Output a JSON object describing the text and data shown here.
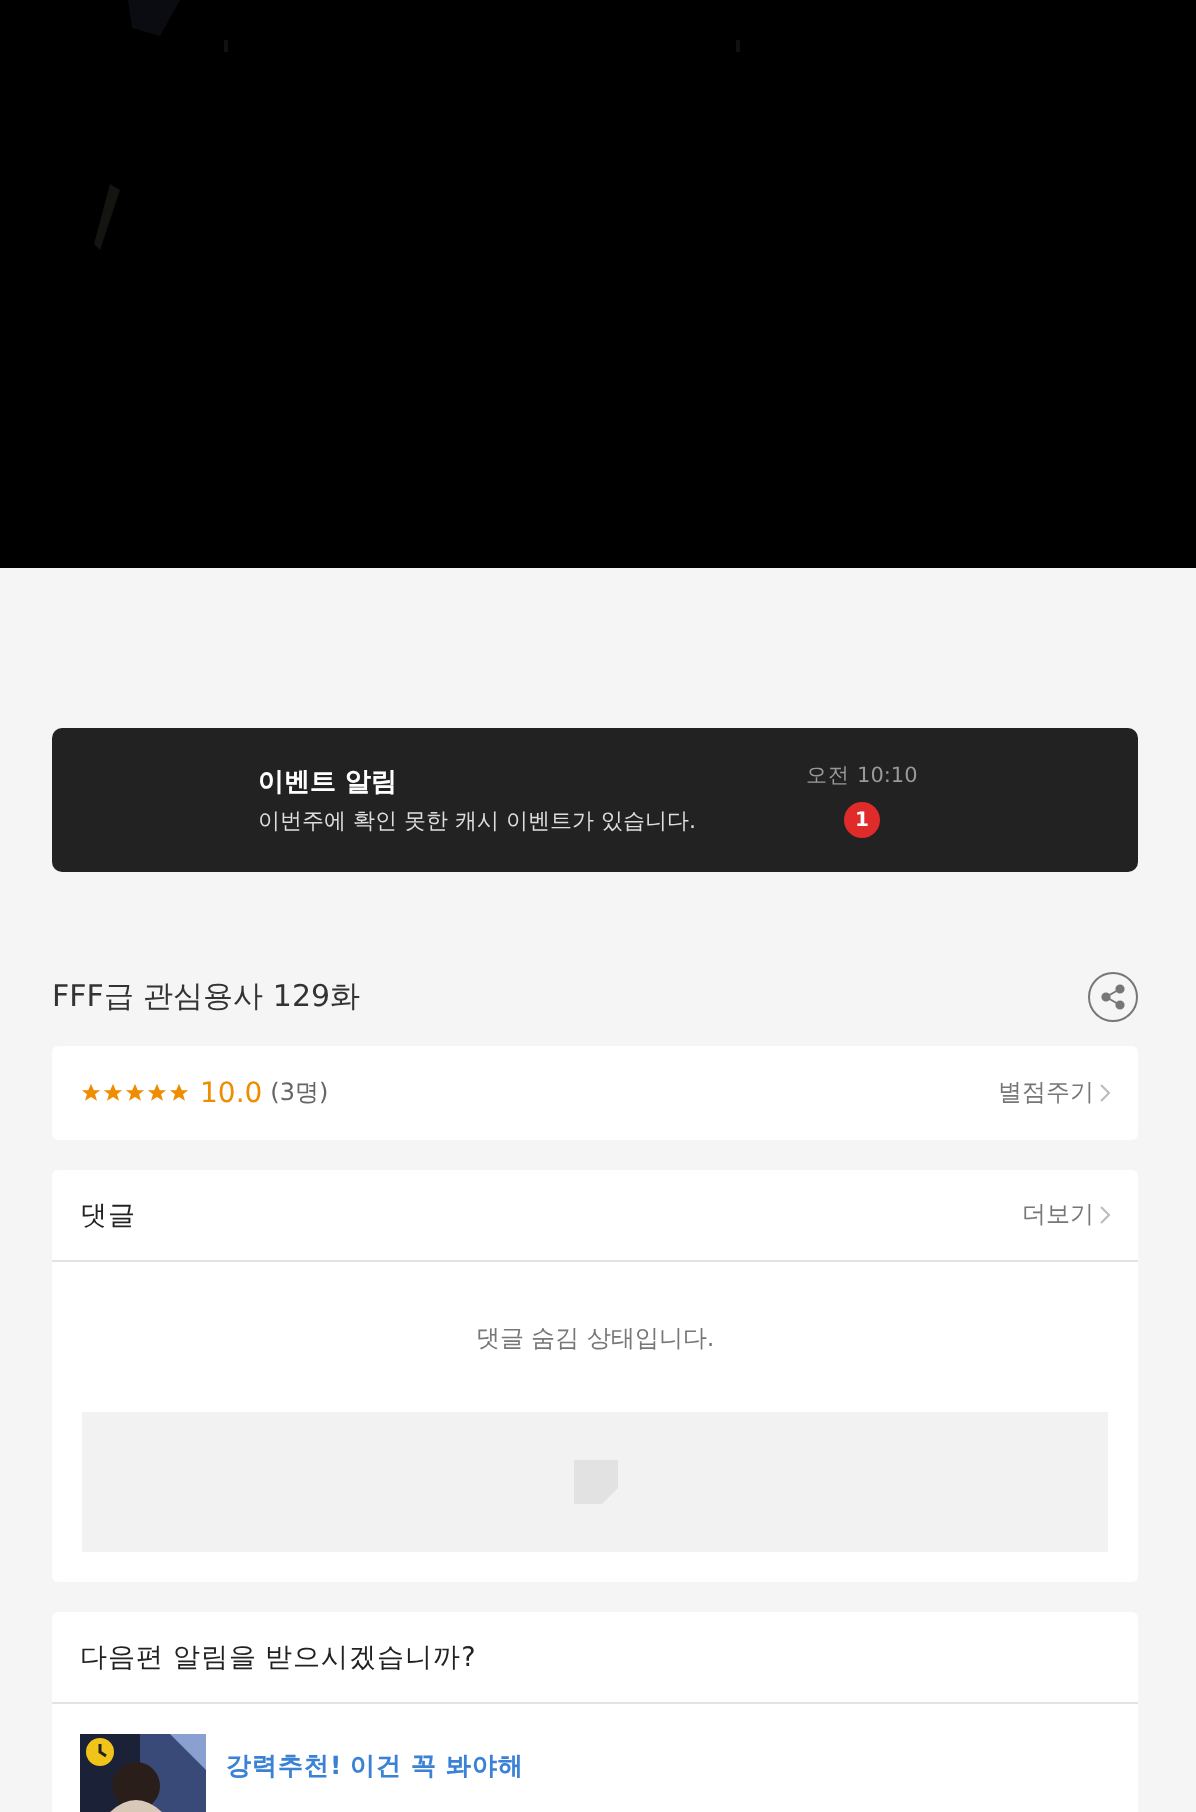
{
  "event_banner": {
    "title": "이벤트 알림",
    "message": "이번주에 확인 못한 캐시 이벤트가 있습니다.",
    "time": "오전 10:10",
    "badge": "1"
  },
  "episode": {
    "title": "FFF급 관심용사 129화"
  },
  "rating": {
    "stars": 5,
    "score": "10.0",
    "count": "(3명)",
    "action": "별점주기"
  },
  "comments": {
    "title": "댓글",
    "more": "더보기",
    "notice": "댓글 숨김 상태입니다."
  },
  "next_alert": {
    "question": "다음편 알림을 받으시겠습니까?",
    "items": [
      {
        "kind": "picture",
        "title": "강력추천! 이건 꼭 봐야해"
      }
    ]
  }
}
